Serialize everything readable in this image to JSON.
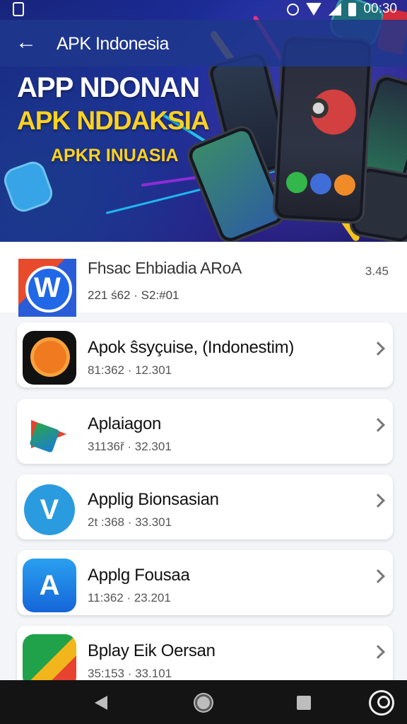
{
  "status_bar": {
    "time": "00:30",
    "icons": [
      "notification-icon",
      "circle-icon",
      "wifi-icon",
      "signal-icon",
      "battery-icon"
    ]
  },
  "app_bar": {
    "title": "APK Indonesia",
    "back_icon": "arrow-left-icon"
  },
  "hero": {
    "line1": "APP NDONAN",
    "line2": "APK NDDAKSIA",
    "line3": "APKR INUASIA",
    "colors": {
      "background": "#1d2e9c",
      "line1": "#ffffff",
      "accent": "#ffd21e"
    }
  },
  "apps": [
    {
      "name": "Fhsac Ehbiadia ARoA",
      "meta": "221 ś62 · S2:#01",
      "right": "3.45",
      "icon": "w-logo-icon"
    },
    {
      "name": "Apok ŝsyçuise, (Indonestim)",
      "meta": "81:362 · 12.301",
      "icon": "sun-face-icon"
    },
    {
      "name": "Aplaiagon",
      "meta": "31136ř · 32.301",
      "icon": "triangle-logo-icon"
    },
    {
      "name": "Applig Bionsasian",
      "meta": "2t :368 · 33.301",
      "icon": "v-gear-icon"
    },
    {
      "name": "Applg Fousaa",
      "meta": "11:362 · 23.201",
      "icon": "a-logo-icon"
    },
    {
      "name": "Bplay Eik Oersan",
      "meta": "35:153 · 33.101",
      "icon": "play-logo-icon"
    }
  ],
  "nav_bar": {
    "icons": [
      "nav-back-icon",
      "nav-home-icon",
      "nav-recents-icon",
      "profile-icon"
    ]
  }
}
